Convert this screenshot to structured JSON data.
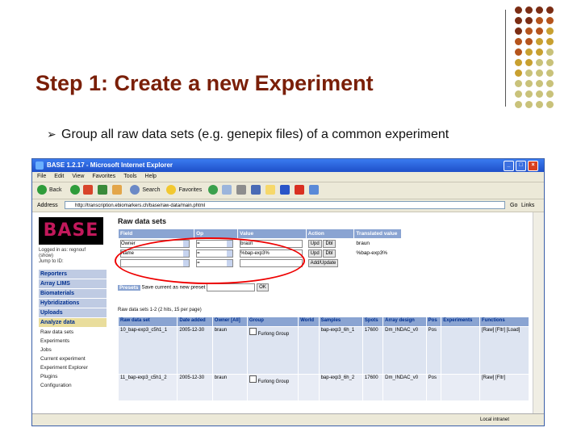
{
  "slide": {
    "title": "Step 1: Create a new Experiment",
    "bullet": "Group all raw data sets (e.g. genepix files) of a common experiment",
    "palette": [
      "#7b2d14",
      "#b5541c",
      "#c8a030",
      "#c9c27a"
    ]
  },
  "window": {
    "title": "BASE 1.2.17 - Microsoft Internet Explorer",
    "menu": [
      "File",
      "Edit",
      "View",
      "Favorites",
      "Tools",
      "Help"
    ],
    "toolbar": {
      "back": "Back",
      "search": "Search",
      "favorites": "Favorites"
    },
    "address_label": "Address",
    "address_value": "http://transcription.ebiomarkers.ch/base/raw-data/main.phtml",
    "go_label": "Go",
    "links_label": "Links",
    "status_text": "Local intranet"
  },
  "nav": {
    "logo": "BASE",
    "login_lines": [
      "Logged in as: regnouf",
      "(show)",
      "Jump to ID:"
    ],
    "items": [
      {
        "label": "Reporters",
        "type": "head"
      },
      {
        "label": "Array LIMS",
        "type": "head"
      },
      {
        "label": "Biomaterials",
        "type": "head"
      },
      {
        "label": "Hybridizations",
        "type": "head"
      },
      {
        "label": "Uploads",
        "type": "head"
      },
      {
        "label": "Analyze data",
        "type": "active"
      },
      {
        "label": "Raw data sets",
        "type": "sub"
      },
      {
        "label": "Experiments",
        "type": "sub"
      },
      {
        "label": "Jobs",
        "type": "sub"
      },
      {
        "label": "Current experiment",
        "type": "sub"
      },
      {
        "label": "Experiment Explorer",
        "type": "sub"
      },
      {
        "label": "Plugins",
        "type": "sub"
      },
      {
        "label": "Configuration",
        "type": "sub"
      }
    ]
  },
  "main": {
    "heading": "Raw data sets",
    "query_headers": [
      "Field",
      "Op",
      "Value",
      "Action",
      "Translated value"
    ],
    "query_rows": [
      {
        "field": "Owner",
        "op": "=",
        "value": "braun",
        "upd": "Upd",
        "dbl": "Dbl",
        "trans": "braun"
      },
      {
        "field": "Name",
        "op": "=",
        "value": "%bap-exp3%",
        "upd": "Upd",
        "dbl": "Dbl",
        "trans": "%bap-exp3%"
      },
      {
        "field": "",
        "op": "=",
        "value": "",
        "upd": "",
        "dbl": "",
        "trans": ""
      }
    ],
    "add_button": "Add/Update",
    "presets_label": "Presets",
    "presets_text": "Save current as new preset",
    "ok": "OK",
    "result_summary": "Raw data sets 1-2 (2 hits, 15 per page)",
    "headers": [
      "Raw data set",
      "Date added",
      "Owner [All]",
      "Group",
      "World",
      "Samples",
      "Spots",
      "Array design",
      "Pos",
      "Experiments",
      "Functions"
    ],
    "rows": [
      {
        "name": "10_bap-exp3_c5h1_1",
        "date": "2005-12-30",
        "owner": "braun",
        "group": "Furlong Group",
        "samples": "bap-exp3_6h_1",
        "spots": "17600",
        "array": "Dm_INDAC_v0",
        "pos": "Pos",
        "exp": "",
        "func": "[Raw] [Fltr] [Load]"
      },
      {
        "name": "11_bap-exp3_c5h1_2",
        "date": "2005-12-30",
        "owner": "braun",
        "group": "Furlong Group",
        "samples": "bap-exp3_6h_2",
        "spots": "17600",
        "array": "Dm_INDAC_v0",
        "pos": "Pos",
        "exp": "",
        "func": "[Raw] [Fltr]"
      }
    ]
  }
}
